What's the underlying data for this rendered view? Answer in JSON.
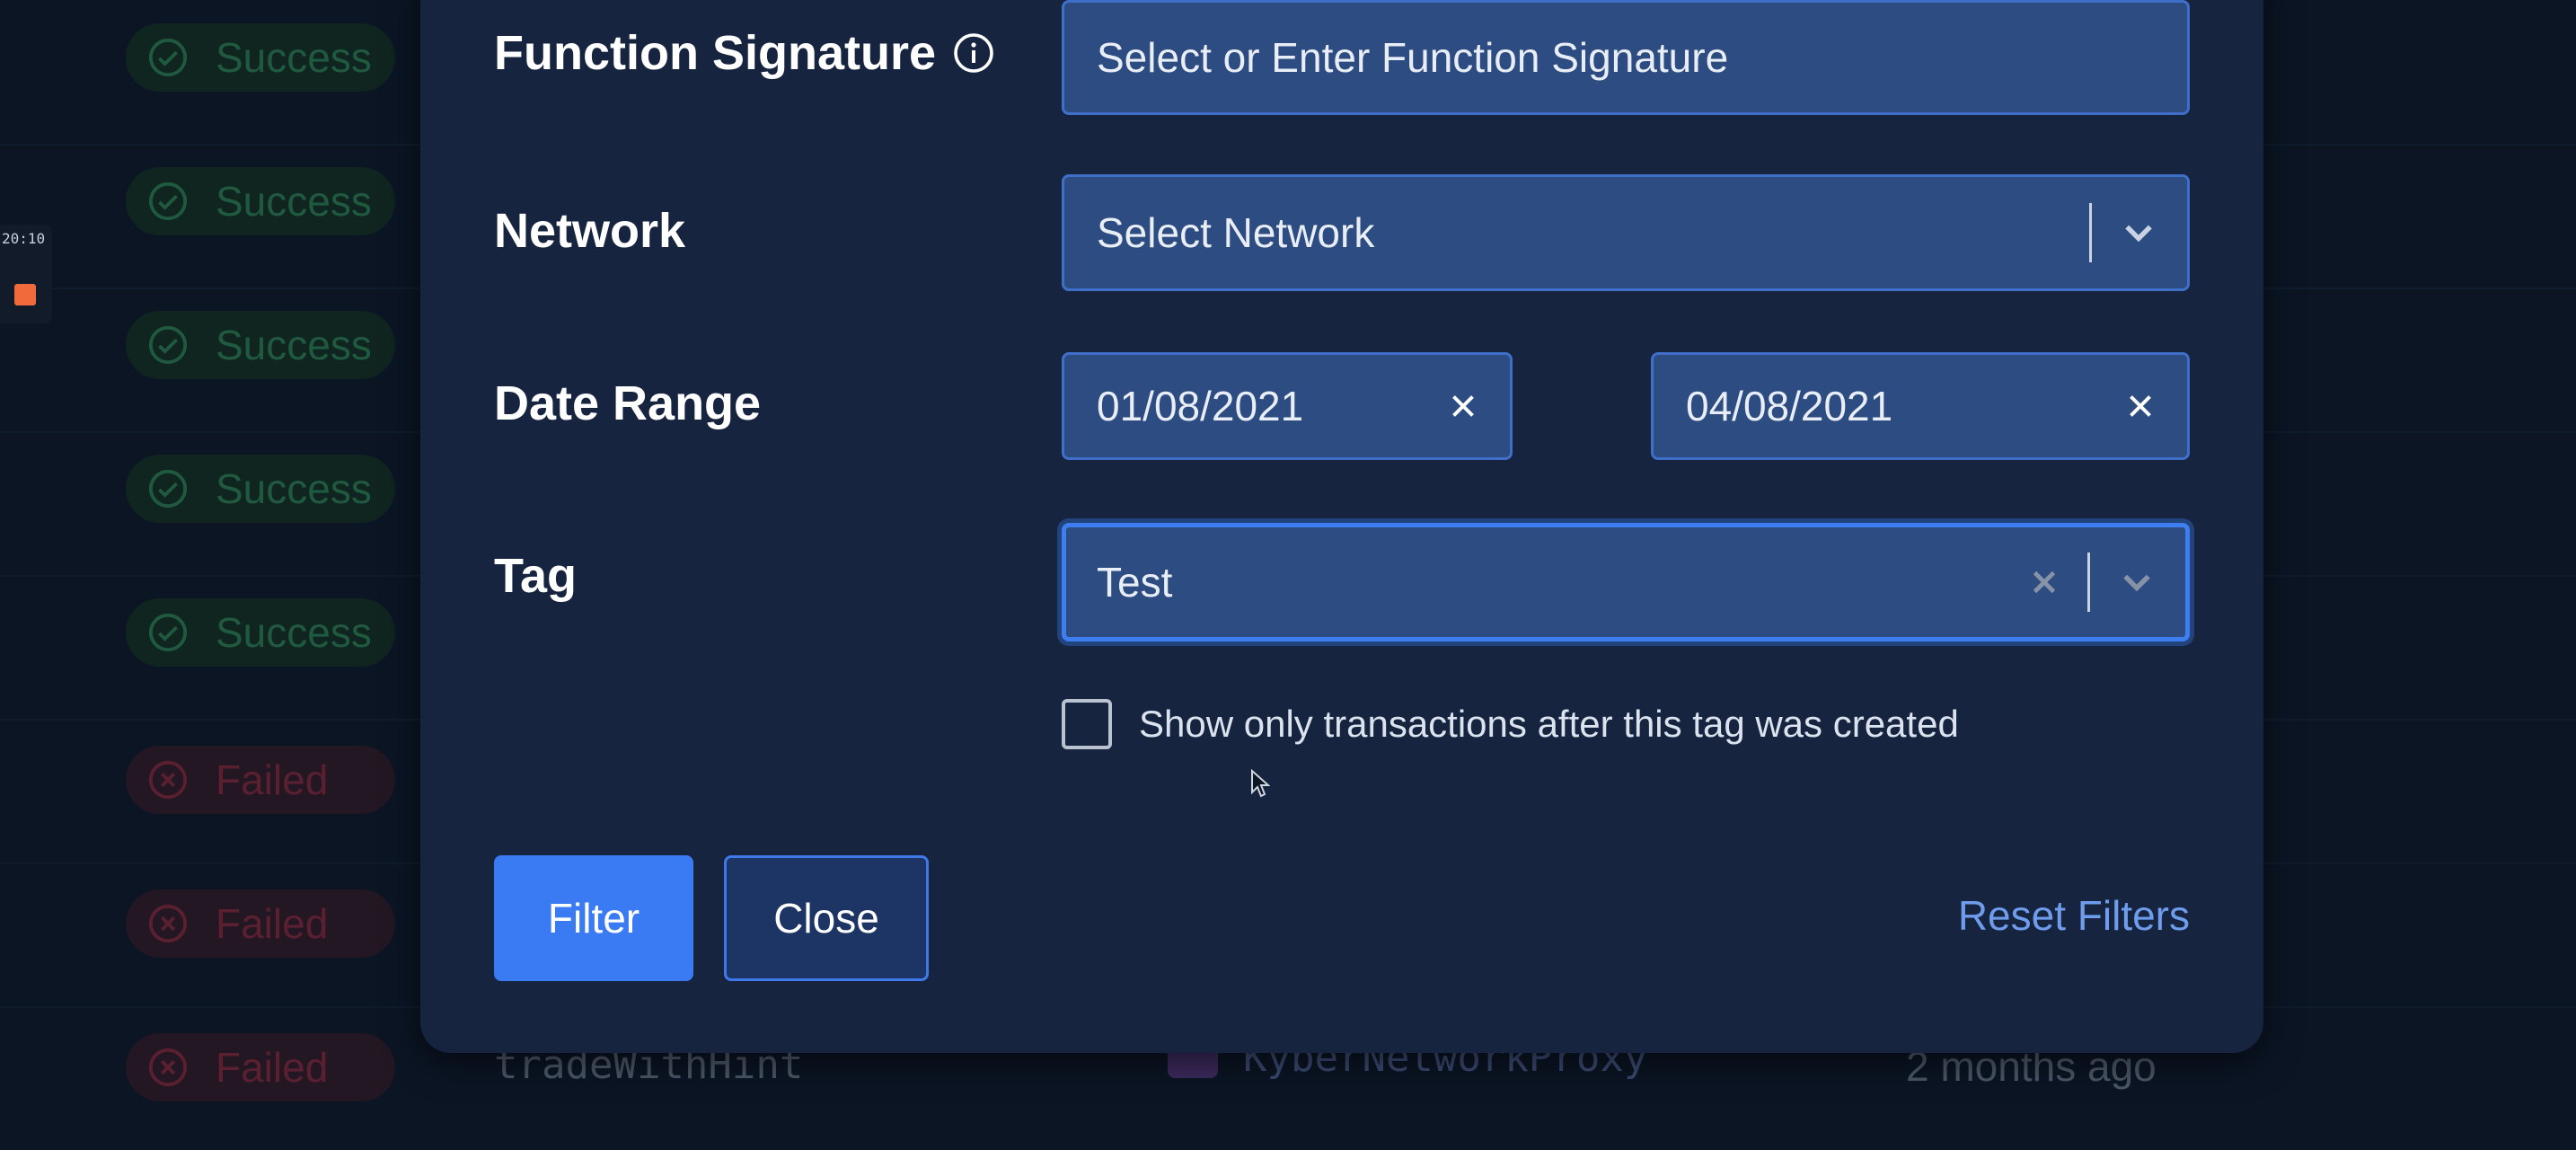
{
  "background_table": {
    "rows": [
      {
        "status": "Success",
        "type": "success"
      },
      {
        "status": "Success",
        "type": "success"
      },
      {
        "status": "Success",
        "type": "success"
      },
      {
        "status": "Success",
        "type": "success"
      },
      {
        "status": "Success",
        "type": "success"
      },
      {
        "status": "Failed",
        "type": "failed"
      },
      {
        "status": "Failed",
        "type": "failed"
      },
      {
        "status": "Failed",
        "type": "failed"
      }
    ],
    "last_row": {
      "function": "tradeWithHint",
      "contract": "KyberNetworkProxy",
      "time": "2 months ago"
    }
  },
  "side_widget": {
    "time": "20:10"
  },
  "filter_modal": {
    "function_signature": {
      "label": "Function Signature",
      "placeholder": "Select or Enter Function Signature",
      "info_icon": "info-icon"
    },
    "network": {
      "label": "Network",
      "placeholder": "Select Network"
    },
    "date_range": {
      "label": "Date Range",
      "start": "01/08/2021",
      "end": "04/08/2021"
    },
    "tag": {
      "label": "Tag",
      "value": "Test"
    },
    "checkbox": {
      "label": "Show only transactions after this tag was created",
      "checked": false
    },
    "buttons": {
      "filter": "Filter",
      "close": "Close",
      "reset": "Reset Filters"
    }
  },
  "colors": {
    "accent": "#3a7bf3",
    "modal_bg": "#16243f",
    "input_bg": "#2c4c82",
    "success_dim": "#1f5a40",
    "failed_dim": "#5a2030"
  }
}
